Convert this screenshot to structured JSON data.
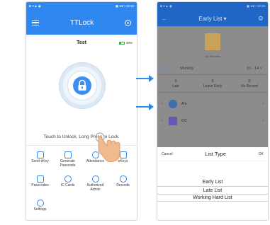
{
  "left_screen": {
    "status_icons": "■ ••▲ ◉",
    "status_time": "▣ ●●□ 18:10",
    "app_title": "TTLock",
    "lock_name": "Test",
    "battery_level": "30%",
    "unlock_hint": "Touch to Unlock, Long Press to Lock.",
    "grid_items": [
      {
        "label": "Send eKey",
        "icon": "send-ekey-icon"
      },
      {
        "label": "Generate Passcode",
        "icon": "generate-passcode-icon"
      },
      {
        "label": "Attendance",
        "icon": "attendance-icon"
      },
      {
        "label": "eKeys",
        "icon": "ekeys-icon"
      },
      {
        "label": "Passcodes",
        "icon": "passcodes-icon"
      },
      {
        "label": "IC Cards",
        "icon": "ic-cards-icon"
      },
      {
        "label": "Authorized Admin",
        "icon": "authorized-admin-icon"
      },
      {
        "label": "Records",
        "icon": "records-icon"
      },
      {
        "label": "Settings",
        "icon": "settings-icon"
      }
    ]
  },
  "right_screen": {
    "status_icons": "■ ••▲ ◉",
    "status_time": "▣ ●●□ 18:25",
    "title": "Early List ▾",
    "no_records": "No Records",
    "tab_daily": "Daily",
    "tab_monthly": "Monthly",
    "date_range": "10 - 14 ˅",
    "stats": [
      {
        "value": "0",
        "label": "Late"
      },
      {
        "value": "0",
        "label": "Leave Early"
      },
      {
        "value": "0",
        "label": "No Record"
      }
    ],
    "groups": [
      {
        "name": "A's"
      },
      {
        "name": "CC"
      }
    ],
    "sheet": {
      "cancel": "Cancel",
      "title": "List Type",
      "ok": "OK",
      "options": [
        "Early List",
        "Late List",
        "Working Hard List"
      ]
    }
  },
  "colors": {
    "brand_blue": "#2f87f0",
    "dark_blue": "#1f66c6",
    "arrow_blue": "#2f8ae8"
  }
}
